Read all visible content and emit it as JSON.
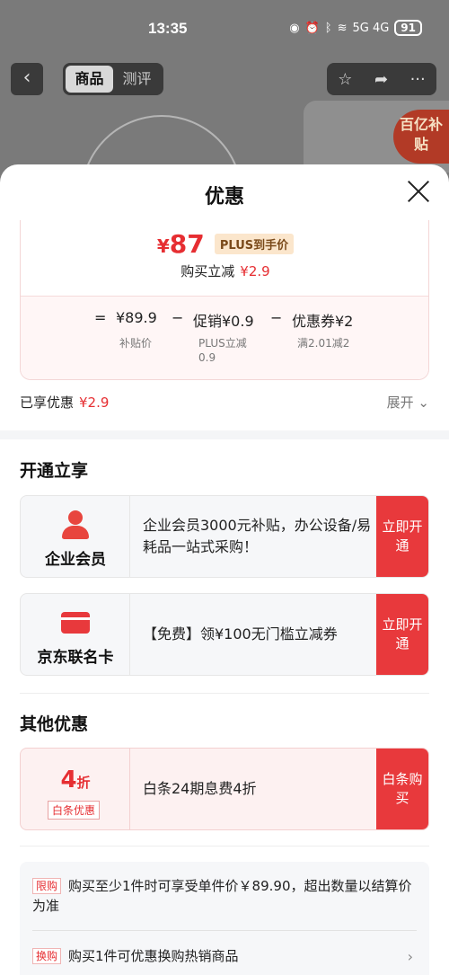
{
  "status_bar": {
    "time": "13:35",
    "network": "5G 4G",
    "battery": "91"
  },
  "background": {
    "tabs": [
      {
        "label": "商品"
      },
      {
        "label": "测评"
      }
    ],
    "subsidy_badge": "百亿补贴"
  },
  "sheet": {
    "title": "优惠",
    "price": {
      "symbol": "¥",
      "value": "87",
      "tag": "PLUS到手价"
    },
    "save": {
      "label": "购买立减",
      "amount": "¥2.9"
    },
    "calc": {
      "eq": "=",
      "minus": "−",
      "items": [
        {
          "value": "¥89.9",
          "sub": "补贴价"
        },
        {
          "value": "促销¥0.9",
          "sub": "PLUS立减0.9"
        },
        {
          "value": "优惠券¥2",
          "sub": "满2.01减2"
        }
      ]
    },
    "enjoyed": {
      "label": "已享优惠",
      "amount": "¥2.9"
    },
    "expand_label": "展开"
  },
  "open_section": {
    "title": "开通立享",
    "offers": [
      {
        "name": "企业会员",
        "desc": "企业会员3000元补贴，办公设备/易耗品一站式采购！",
        "action": "立即开通"
      },
      {
        "name": "京东联名卡",
        "desc": "【免费】领¥100无门槛立减券",
        "action": "立即开通"
      }
    ]
  },
  "other_section": {
    "title": "其他优惠",
    "offer": {
      "fold_num": "4",
      "fold_unit": "折",
      "tag": "白条优惠",
      "desc": "白条24期息费4折",
      "action": "白条购买"
    }
  },
  "rules": [
    {
      "tag": "限购",
      "text": "购买至少1件时可享受单件价￥89.90，超出数量以结算价为准"
    },
    {
      "tag": "换购",
      "text": "购买1件可优惠换购热销商品"
    }
  ],
  "colors": {
    "accent": "#e8393c",
    "price_red": "#e62e32"
  }
}
